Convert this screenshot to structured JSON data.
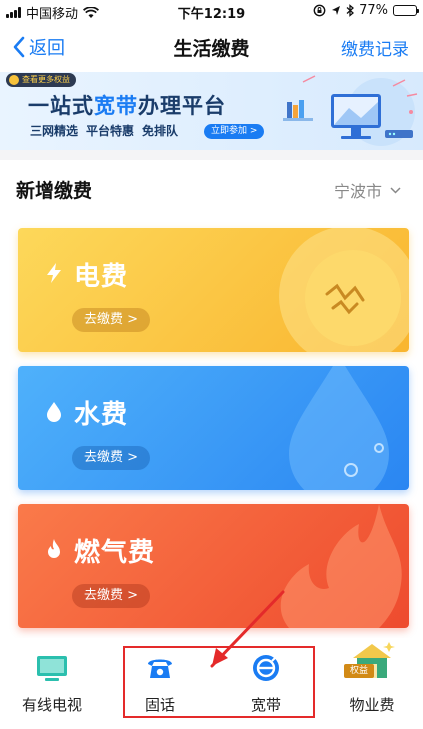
{
  "status_bar": {
    "carrier": "中国移动",
    "time": "下午12:19",
    "battery": "77%",
    "battery_level": 0.77
  },
  "nav": {
    "back_label": "返回",
    "title": "生活缴费",
    "record_label": "缴费记录"
  },
  "banner": {
    "tag": "查看更多权益",
    "title_prefix": "一站式",
    "title_highlight": "宽带",
    "title_suffix": "办理平台",
    "subs": [
      "三网精选",
      "平台特惠",
      "免排队"
    ],
    "cta": "立即参加 >"
  },
  "section": {
    "title": "新增缴费",
    "city": "宁波市"
  },
  "cards": [
    {
      "name": "电费",
      "button": "去缴费 >"
    },
    {
      "name": "水费",
      "button": "去缴费 >"
    },
    {
      "name": "燃气费",
      "button": "去缴费 >"
    }
  ],
  "bottom_items": [
    {
      "label": "有线电视"
    },
    {
      "label": "固话"
    },
    {
      "label": "宽带"
    },
    {
      "label": "物业费",
      "badge": "权益"
    }
  ],
  "colors": {
    "accent": "#1a7cf3",
    "electric": "#f9b52f",
    "water": "#2a86f2",
    "gas": "#ee4b2e",
    "annotation": "#e42a2a"
  }
}
